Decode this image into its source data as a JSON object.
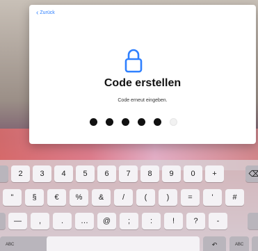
{
  "dialog": {
    "back_label": "Zurück",
    "title": "Code erstellen",
    "subtitle": "Code erneut eingeben.",
    "passcode": {
      "filled": 5,
      "total": 6
    }
  },
  "keyboard": {
    "row1": [
      "2",
      "3",
      "4",
      "5",
      "6",
      "7",
      "8",
      "9",
      "0",
      "+"
    ],
    "row2": [
      "\"",
      "§",
      "€",
      "%",
      "&",
      "/",
      "(",
      ")",
      "=",
      "'",
      "#"
    ],
    "row3": [
      "—",
      ",",
      ".",
      "…",
      "@",
      ";",
      ":",
      "!",
      "?",
      "-"
    ],
    "bottom": {
      "abc_left": "ABC",
      "abc_right": "ABC"
    }
  },
  "colors": {
    "accent": "#2f80ff"
  }
}
